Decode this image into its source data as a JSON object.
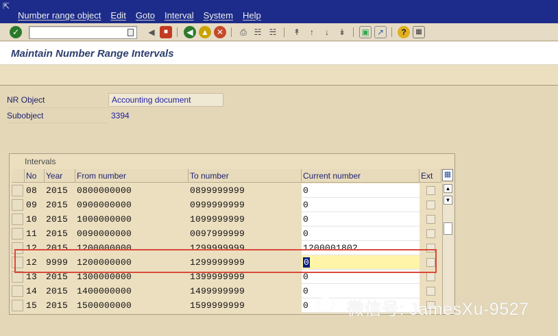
{
  "menubar": {
    "items": [
      "Number range object",
      "Edit",
      "Goto",
      "Interval",
      "System",
      "Help"
    ]
  },
  "toolbar": {
    "command_field_value": ""
  },
  "title": "Maintain Number Range Intervals",
  "fields": {
    "nr_object_label": "NR Object",
    "nr_object_value": "Accounting document",
    "subobject_label": "Subobject",
    "subobject_value": "3394"
  },
  "intervals": {
    "title": "Intervals",
    "headers": {
      "no": "No",
      "year": "Year",
      "from": "From number",
      "to": "To number",
      "current": "Current number",
      "ext": "Ext"
    },
    "rows": [
      {
        "no": "08",
        "year": "2015",
        "from": "0800000000",
        "to": "0899999999",
        "current": "0"
      },
      {
        "no": "09",
        "year": "2015",
        "from": "0900000000",
        "to": "0999999999",
        "current": "0"
      },
      {
        "no": "10",
        "year": "2015",
        "from": "1000000000",
        "to": "1099999999",
        "current": "0"
      },
      {
        "no": "11",
        "year": "2015",
        "from": "0090000000",
        "to": "0097999999",
        "current": "0"
      },
      {
        "no": "12",
        "year": "2015",
        "from": "1200000000",
        "to": "1299999999",
        "current": "1200001802"
      },
      {
        "no": "12",
        "year": "9999",
        "from": "1200000000",
        "to": "1299999999",
        "current": "0"
      },
      {
        "no": "13",
        "year": "2015",
        "from": "1300000000",
        "to": "1399999999",
        "current": "0"
      },
      {
        "no": "14",
        "year": "2015",
        "from": "1400000000",
        "to": "1499999999",
        "current": "0"
      },
      {
        "no": "15",
        "year": "2015",
        "from": "1500000000",
        "to": "1599999999",
        "current": "0"
      }
    ]
  },
  "watermark": "微信号: JamesXu-9527"
}
